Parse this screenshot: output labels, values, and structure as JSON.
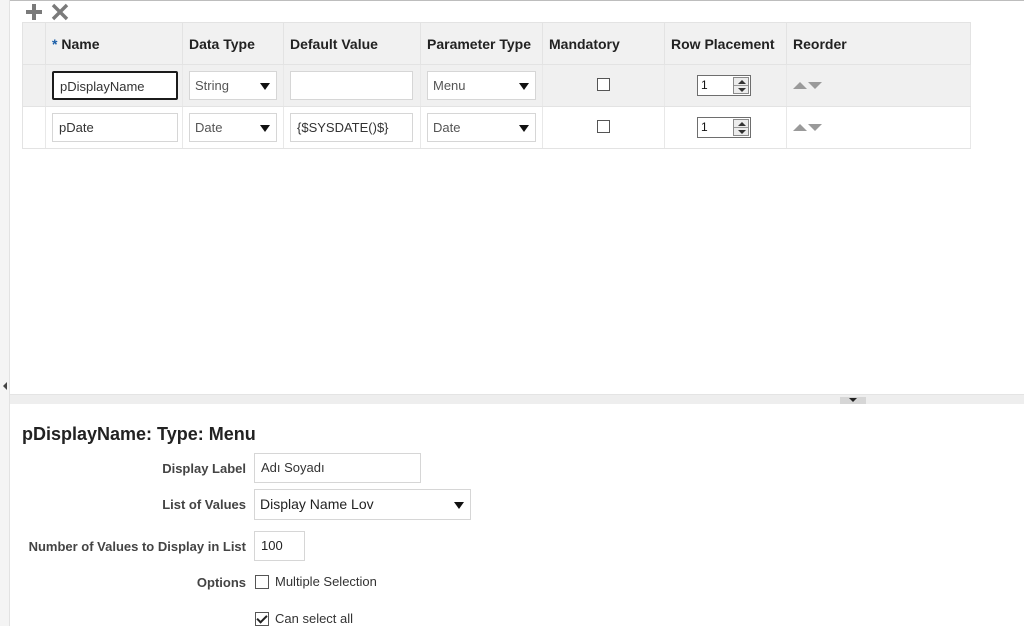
{
  "toolbar": {
    "add_icon": "plus-icon",
    "delete_icon": "x-icon"
  },
  "table": {
    "required_marker": "*",
    "headers": {
      "name": "Name",
      "data_type": "Data Type",
      "default_value": "Default Value",
      "parameter_type": "Parameter Type",
      "mandatory": "Mandatory",
      "row_placement": "Row Placement",
      "reorder": "Reorder"
    },
    "rows": [
      {
        "name": "pDisplayName",
        "data_type": "String",
        "default_value": "",
        "parameter_type": "Menu",
        "mandatory": false,
        "row_placement": "1"
      },
      {
        "name": "pDate",
        "data_type": "Date",
        "default_value": "{$SYSDATE()$}",
        "parameter_type": "Date",
        "mandatory": false,
        "row_placement": "1"
      }
    ]
  },
  "detail": {
    "title": "pDisplayName: Type: Menu",
    "display_label": {
      "label": "Display Label",
      "value": "Adı Soyadı"
    },
    "list_of_values": {
      "label": "List of Values",
      "value": "Display Name Lov"
    },
    "num_values": {
      "label": "Number of Values to Display in List",
      "value": "100"
    },
    "options": {
      "label": "Options",
      "multiple_selection": {
        "label": "Multiple Selection",
        "checked": false
      },
      "can_select_all": {
        "label": "Can select all",
        "checked": true
      }
    }
  }
}
